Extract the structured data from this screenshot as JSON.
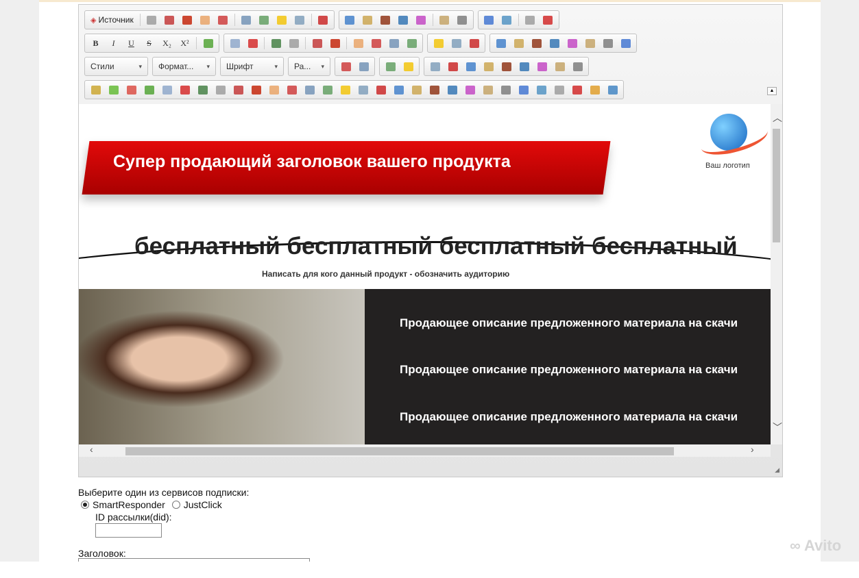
{
  "toolbar": {
    "source_label": "Источник",
    "row1_icons": [
      "find-icon",
      "select-all-icon",
      "undo-icon",
      "redo-icon",
      "code-icon",
      "save-icon",
      "new-page-icon",
      "preview-icon",
      "print-icon",
      "templates-icon",
      "cut-icon",
      "copy-icon",
      "paste-icon",
      "paste-text-icon",
      "paste-word-icon",
      "undo2-icon",
      "redo2-icon",
      "search-replace-icon",
      "replace-icon",
      "maximize-icon",
      "spellcheck-icon"
    ],
    "row2_format": [
      "B",
      "I",
      "U",
      "S",
      "X₂",
      "X²"
    ],
    "row2_icons": [
      "image-icon",
      "ordered-list-icon",
      "bullet-list-icon",
      "outdent-icon",
      "indent-icon",
      "blockquote-icon",
      "div-icon",
      "align-left-icon",
      "align-center-icon",
      "align-right-icon",
      "justify-icon",
      "link-icon",
      "unlink-icon",
      "anchor-icon",
      "image2-icon",
      "flash-icon",
      "table-icon",
      "hr-icon",
      "smiley-icon",
      "special-char-icon",
      "pagebreak-icon",
      "iframe-icon"
    ],
    "combos": {
      "styles": "Стили",
      "format": "Формат...",
      "font": "Шрифт",
      "size": "Ра..."
    },
    "row3_icons": [
      "text-color-icon",
      "table-grid-icon",
      "blocks-icon",
      "showblocks-icon",
      "form-icon",
      "checkbox-icon",
      "radio-icon",
      "textfield-icon",
      "textarea-icon",
      "select-icon",
      "button-icon",
      "imagebutton-icon",
      "hiddenfield-icon"
    ],
    "row4_icons": [
      "badge-icon",
      "arrow-down-icon",
      "ribbon-icon",
      "check-icon",
      "user-card-icon",
      "warning-icon",
      "window-icon",
      "gift-icon",
      "alarm-icon",
      "stop-icon",
      "thumbs-up-icon",
      "minus-icon",
      "layout-icon",
      "layout2-icon",
      "notes-icon",
      "wave-icon",
      "red-button-icon",
      "calendar-icon",
      "pen-icon",
      "ball-icon",
      "qr-icon",
      "palette-icon",
      "document-icon",
      "gear-icon",
      "help-icon",
      "box-icon",
      "photo-icon",
      "youtube-icon",
      "audio-icon",
      "bug-icon"
    ],
    "colors": [
      "#c9a227",
      "#5cb82c",
      "#d9453b",
      "#4aa02c",
      "#8aa4c8",
      "#d32020",
      "#3c7a3c",
      "#999999",
      "#c03030",
      "#c21c00",
      "#e8a060",
      "#cc3333",
      "#6d8fb3",
      "#5b9b5b",
      "#f2c200",
      "#7a9bb8",
      "#c81e1e",
      "#3a7bc8",
      "#c9a34a",
      "#8b2c0c",
      "#2a6fb0",
      "#c040c0",
      "#c2a060",
      "#777777",
      "#3a6fd0",
      "#4a8fc0",
      "#999999",
      "#d01f1f",
      "#e09a20",
      "#3a80c0"
    ]
  },
  "content": {
    "banner": "Супер продающий заголовок вашего продукта",
    "logo_text": "Ваш логотип",
    "headline": "бесплатный бесплатный бесплатный бесплатный",
    "subtitle": "Написать для кого данный продукт - обозначить аудиторию",
    "descriptions": [
      "Продающее описание предложенного материала на скачи",
      "Продающее описание предложенного материала на скачи",
      "Продающее описание предложенного материала на скачи"
    ]
  },
  "form": {
    "service_label": "Выберите один из сервисов подписки:",
    "options": [
      {
        "label": "SmartResponder",
        "selected": true
      },
      {
        "label": "JustClick",
        "selected": false
      }
    ],
    "did_label": "ID рассылки(did):",
    "did_value": "",
    "title_label": "Заголовок:"
  },
  "watermark": "Avito"
}
